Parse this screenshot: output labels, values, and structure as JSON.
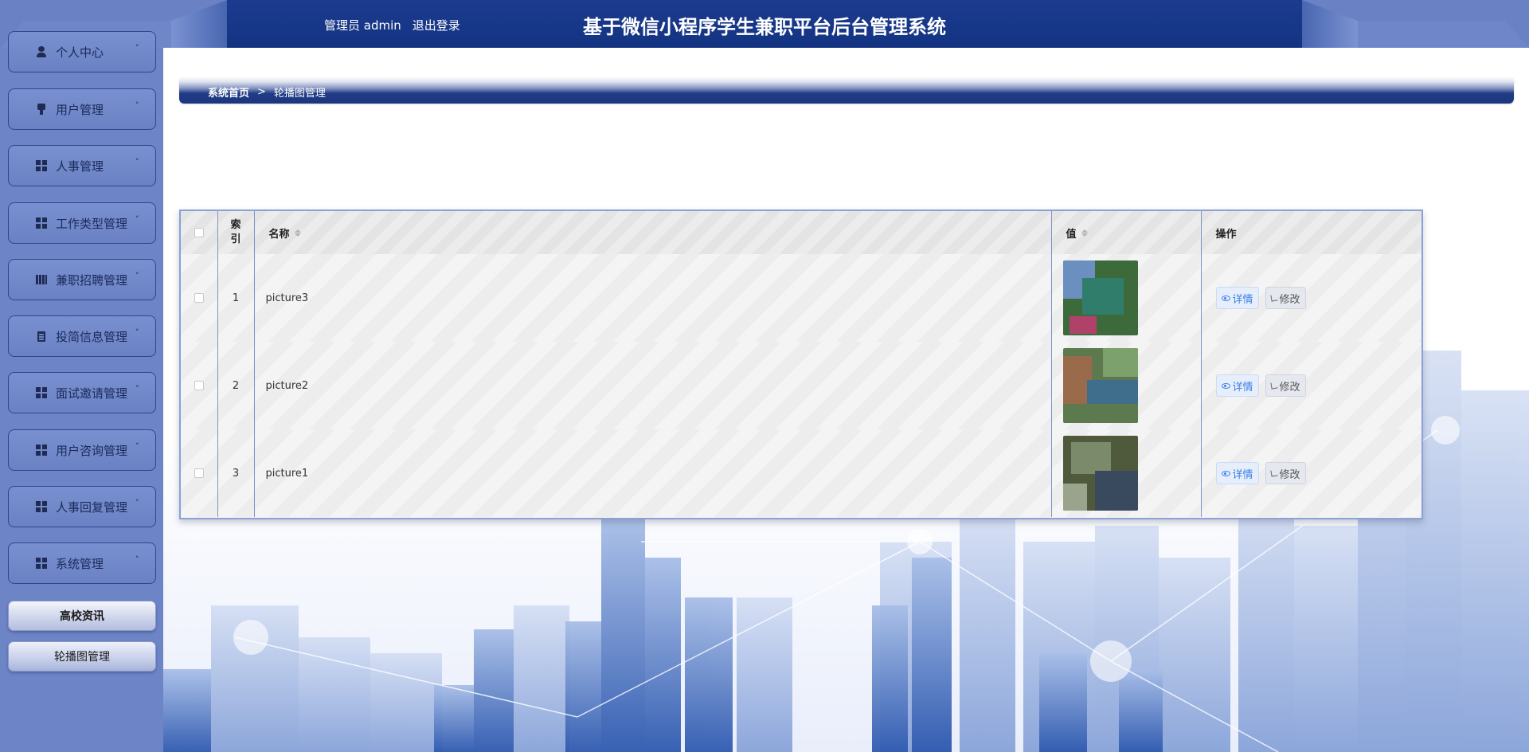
{
  "header": {
    "admin_role": "管理员",
    "admin_name": "admin",
    "logout_label": "退出登录",
    "title": "基于微信小程序学生兼职平台后台管理系统"
  },
  "sidebar": {
    "items": [
      {
        "label": "个人中心",
        "icon": "person-icon",
        "arrow": "˅"
      },
      {
        "label": "用户管理",
        "icon": "stamp-icon",
        "arrow": "˅"
      },
      {
        "label": "人事管理",
        "icon": "grid-icon",
        "arrow": "˅"
      },
      {
        "label": "工作类型管理",
        "icon": "grid-icon",
        "arrow": "˅"
      },
      {
        "label": "兼职招聘管理",
        "icon": "book-icon",
        "arrow": "˅"
      },
      {
        "label": "投简信息管理",
        "icon": "clipboard-icon",
        "arrow": "˅"
      },
      {
        "label": "面试邀请管理",
        "icon": "grid-icon",
        "arrow": "˅"
      },
      {
        "label": "用户咨询管理",
        "icon": "grid-icon",
        "arrow": "˅"
      },
      {
        "label": "人事回复管理",
        "icon": "grid-icon",
        "arrow": "˅"
      },
      {
        "label": "系统管理",
        "icon": "grid-icon",
        "arrow": "˄"
      }
    ],
    "subitems": [
      {
        "label": "高校资讯"
      },
      {
        "label": "轮播图管理"
      }
    ]
  },
  "breadcrumb": {
    "home": "系统首页",
    "separator": ">",
    "current": "轮播图管理"
  },
  "table": {
    "headers": {
      "index": "索引",
      "name": "名称",
      "value": "值",
      "actions": "操作"
    },
    "rows": [
      {
        "index": "1",
        "name": "picture3",
        "thumb_colors": [
          "#3d6a3a",
          "#6b8fbf",
          "#2f7d6a",
          "#b0426a"
        ]
      },
      {
        "index": "2",
        "name": "picture2",
        "thumb_colors": [
          "#5d7a4f",
          "#9a6b4a",
          "#3f6e8c",
          "#7da16d"
        ]
      },
      {
        "index": "3",
        "name": "picture1",
        "thumb_colors": [
          "#4f5a3d",
          "#7a8a6a",
          "#3a4a5e",
          "#9aa48c"
        ]
      }
    ],
    "detail_label": "详情",
    "edit_label": "修改"
  },
  "colors": {
    "header_dark": "#133382",
    "sidebar": "#6d84c6",
    "table_border": "#8aa0d6",
    "detail_text": "#3c7ee6"
  }
}
